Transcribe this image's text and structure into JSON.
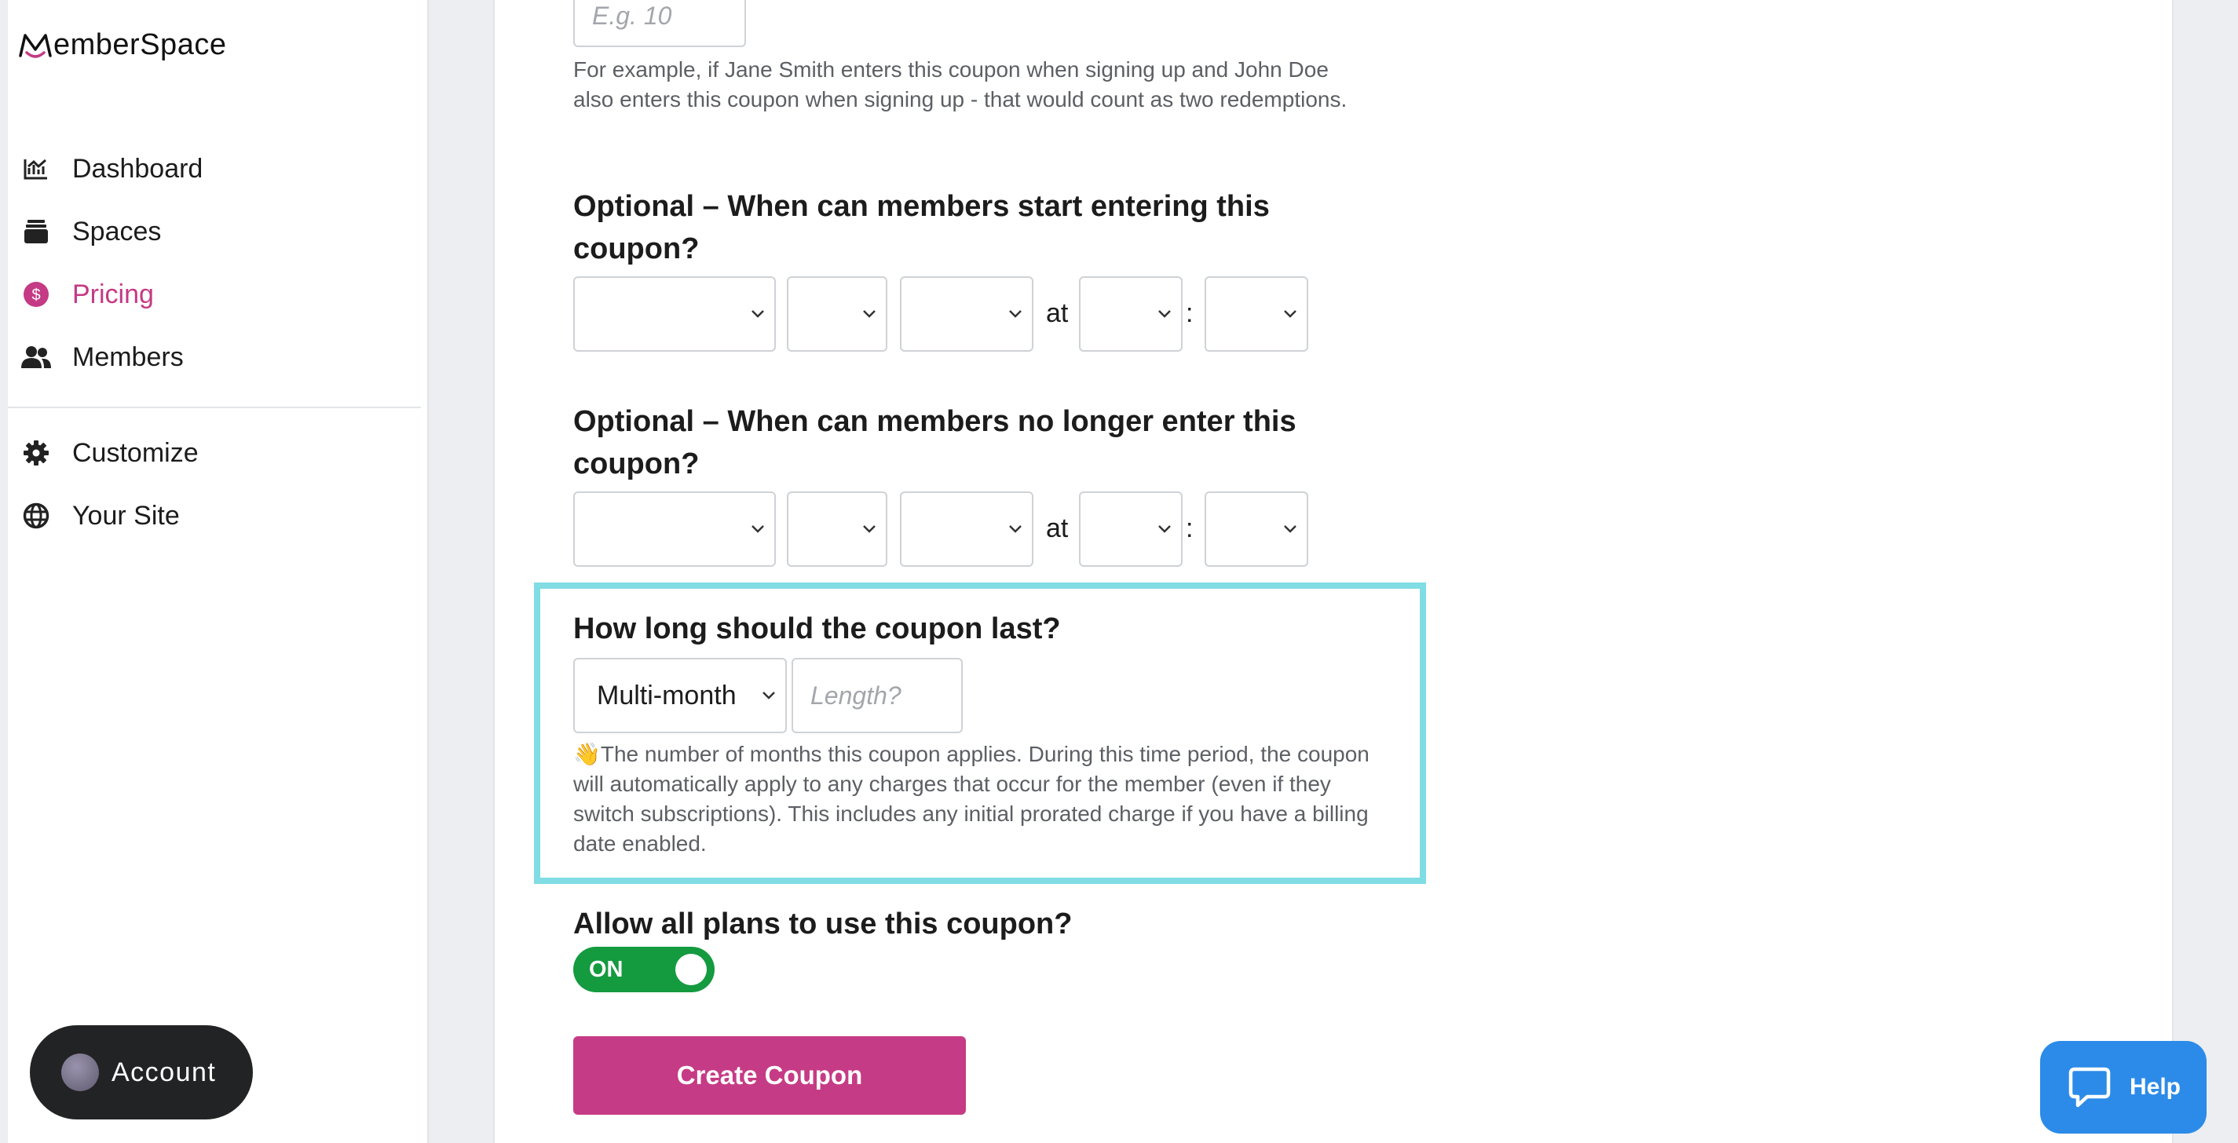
{
  "app": {
    "logo_text": "emberSpace"
  },
  "sidebar": {
    "items": [
      {
        "label": "Dashboard",
        "icon": "chart-line-icon"
      },
      {
        "label": "Spaces",
        "icon": "layers-icon"
      },
      {
        "label": "Pricing",
        "icon": "dollar-circle-icon",
        "active": true
      },
      {
        "label": "Members",
        "icon": "users-icon"
      },
      {
        "label": "Customize",
        "icon": "gear-icon"
      },
      {
        "label": "Your Site",
        "icon": "globe-icon"
      }
    ],
    "account_label": "Account"
  },
  "form": {
    "max_redemptions": {
      "placeholder": "E.g. 10",
      "help": "For example, if Jane Smith enters this coupon when signing up and John Doe also enters this coupon when signing up - that would count as two redemptions."
    },
    "start": {
      "label": "Optional – When can members start entering this coupon?",
      "at_label": "at",
      "colon": ":"
    },
    "end": {
      "label": "Optional – When can members no longer enter this coupon?",
      "at_label": "at",
      "colon": ":"
    },
    "duration": {
      "label": "How long should the coupon last?",
      "selected": "Multi-month",
      "length_placeholder": "Length?",
      "help": "👋The number of months this coupon applies. During this time period, the coupon will automatically apply to any charges that occur for the member (even if they switch subscriptions). This includes any initial prorated charge if you have a billing date enabled."
    },
    "all_plans": {
      "label": "Allow all plans to use this coupon?",
      "toggle_label": "ON",
      "toggle_on": true
    },
    "submit_label": "Create Coupon"
  },
  "help_widget": {
    "label": "Help"
  },
  "colors": {
    "accent": "#c63b85",
    "toggle_on": "#149a3f",
    "help_button": "#2c8be8",
    "highlight_border": "#7fdde3"
  }
}
